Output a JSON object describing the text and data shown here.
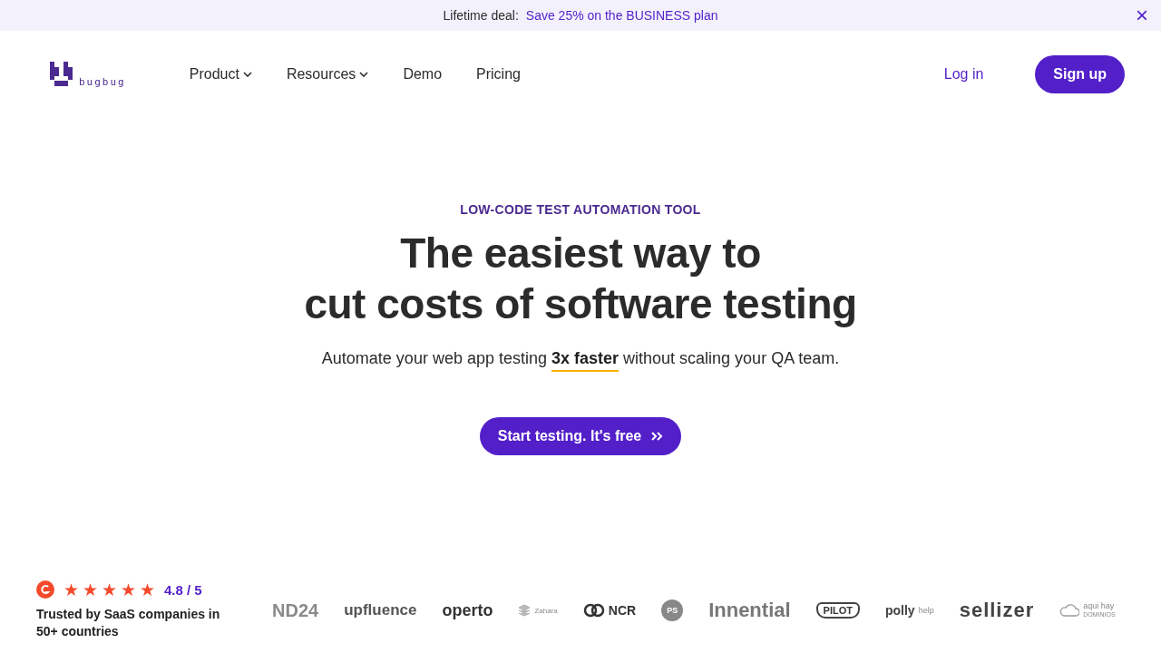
{
  "banner": {
    "label": "Lifetime deal:",
    "link": "Save 25% on the BUSINESS plan",
    "close": "×"
  },
  "header": {
    "brand": "bugbug",
    "nav": [
      {
        "label": "Product",
        "dropdown": true
      },
      {
        "label": "Resources",
        "dropdown": true
      },
      {
        "label": "Demo",
        "dropdown": false
      },
      {
        "label": "Pricing",
        "dropdown": false
      }
    ],
    "login": "Log in",
    "signup": "Sign up"
  },
  "hero": {
    "eyebrow": "LOW-CODE TEST AUTOMATION TOOL",
    "title_lines": [
      "The easiest way to",
      "cut costs of software testing"
    ],
    "subtitle": "Automate your web app testing **3x faster** without scaling your QA team.",
    "cta": "Start testing. It's free"
  },
  "rating": {
    "stars": 5,
    "score": "4.8 / 5",
    "caption": "Trusted by SaaS companies in 50+ countries"
  },
  "logos": [
    {
      "kind": "word",
      "text": "ND24"
    },
    {
      "kind": "word",
      "text": "upfluence"
    },
    {
      "kind": "word",
      "text": "operto"
    },
    {
      "kind": "stack",
      "text": "Zahara"
    },
    {
      "kind": "rings",
      "text": "NCR"
    },
    {
      "kind": "circle",
      "text": "PS"
    },
    {
      "kind": "word",
      "text": "Innential"
    },
    {
      "kind": "badge",
      "text": "PILOT"
    },
    {
      "kind": "sub",
      "text": "polly",
      "sub": "help"
    },
    {
      "kind": "word",
      "text": "sellizer"
    },
    {
      "kind": "cloud",
      "text": "aqui hay",
      "sub": "DOMINIOS"
    }
  ]
}
